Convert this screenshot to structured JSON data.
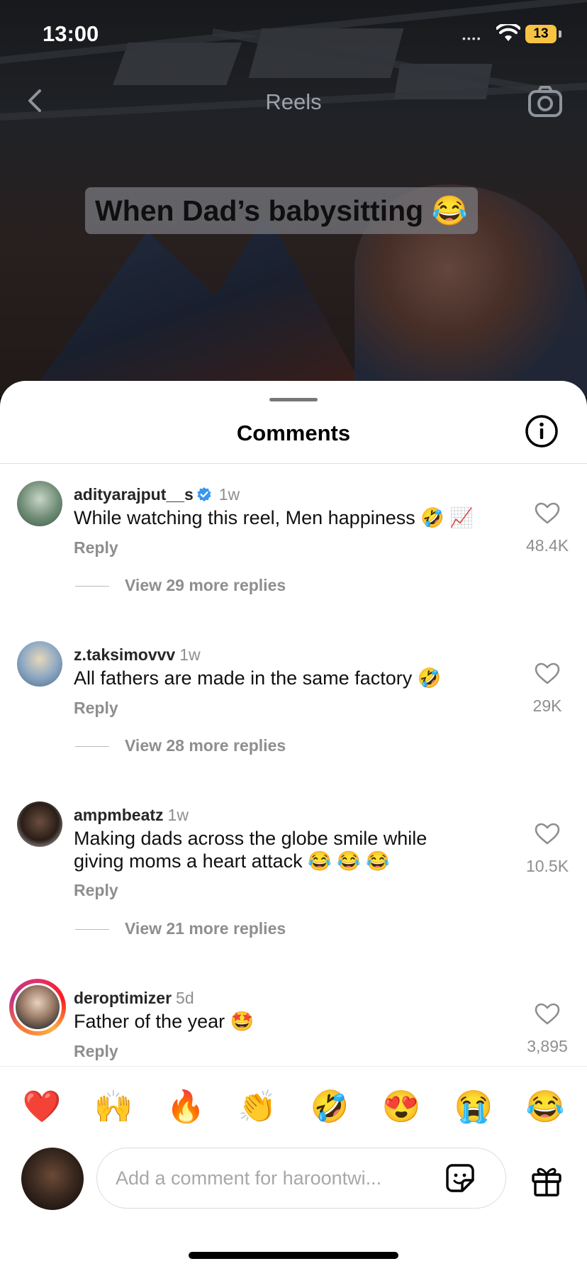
{
  "status_bar": {
    "time": "13:00",
    "signal": "••••",
    "battery": "13"
  },
  "nav": {
    "title": "Reels"
  },
  "video": {
    "caption": "When Dad’s babysitting 😂"
  },
  "sheet": {
    "title": "Comments"
  },
  "comments": [
    {
      "username": "adityarajput__s",
      "verified": true,
      "age": "1w",
      "text": "While watching this reel, Men happiness 🤣 📈",
      "reply": "Reply",
      "likes": "48.4K",
      "view_more": "View 29 more replies"
    },
    {
      "username": "z.taksimovvv",
      "verified": false,
      "age": "1w",
      "text": "All fathers are made in the same factory 🤣",
      "reply": "Reply",
      "likes": "29K",
      "view_more": "View 28 more replies"
    },
    {
      "username": "ampmbeatz",
      "verified": false,
      "age": "1w",
      "text": "Making dads across the globe smile while giving moms a heart attack 😂 😂 😂",
      "reply": "Reply",
      "likes": "10.5K",
      "view_more": "View 21 more replies"
    },
    {
      "username": "deroptimizer",
      "verified": false,
      "age": "5d",
      "text": "Father of the year 🤩",
      "reply": "Reply",
      "likes": "3,895"
    }
  ],
  "emoji_bar": [
    "❤️",
    "🙌",
    "🔥",
    "👏",
    "🤣",
    "😍",
    "😭",
    "😂"
  ],
  "composer": {
    "placeholder": "Add a comment for haroontwi..."
  },
  "colors": {
    "verified": "#3897f0",
    "accent_ring": "#e1306c",
    "battery": "#f6c343"
  },
  "icons": [
    "back-chevron-icon",
    "camera-icon",
    "info-icon",
    "verified-badge-icon",
    "heart-icon",
    "sticker-icon",
    "gift-icon",
    "wifi-icon"
  ]
}
